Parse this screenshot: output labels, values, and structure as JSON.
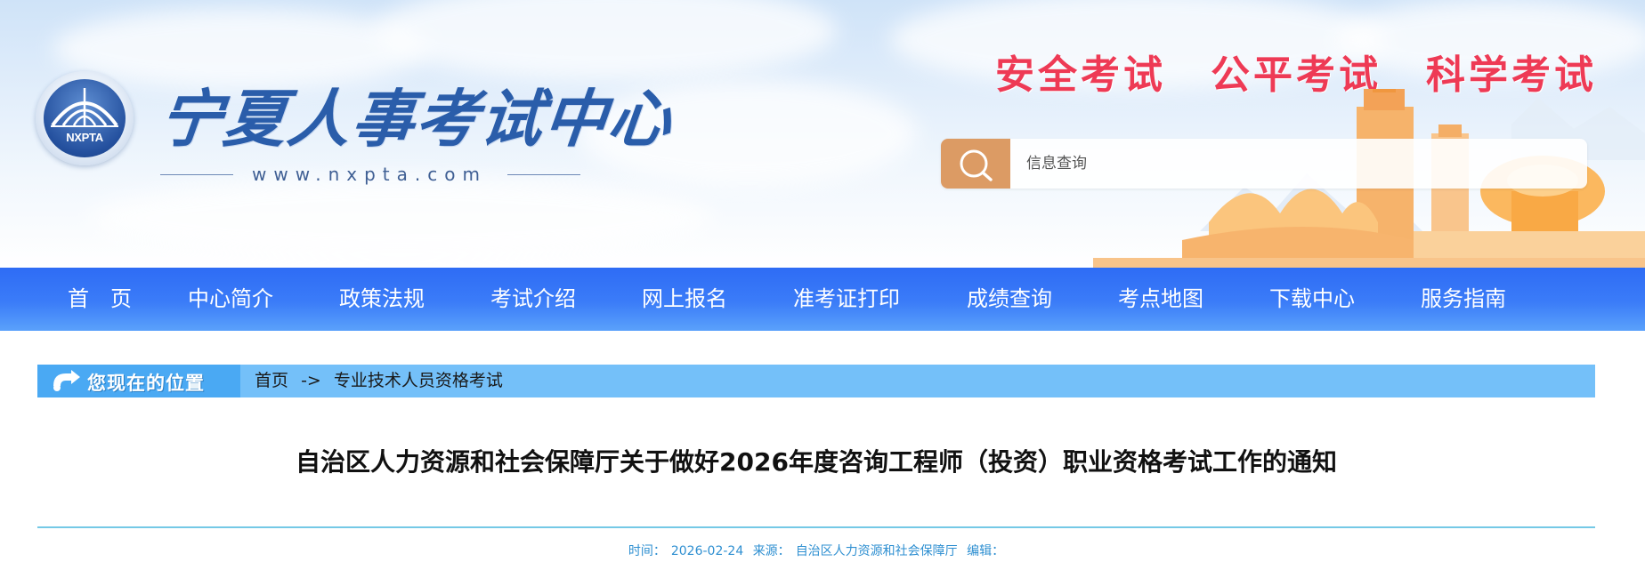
{
  "header": {
    "logo_text": "NXPTA",
    "site_title": "宁夏人事考试中心",
    "site_url": "www.nxpta.com",
    "slogans": [
      "安全考试",
      "公平考试",
      "科学考试"
    ],
    "search": {
      "placeholder": "信息查询",
      "icon": "search-icon"
    },
    "colors": {
      "slogan": "#ee3a55",
      "title": "#2a5daa",
      "search_button": "#dc9b64"
    }
  },
  "nav": {
    "items": [
      "首　页",
      "中心简介",
      "政策法规",
      "考试介绍",
      "网上报名",
      "准考证打印",
      "成绩查询",
      "考点地图",
      "下载中心",
      "服务指南"
    ],
    "colors": {
      "background": "#3b7cf8"
    }
  },
  "breadcrumb": {
    "label": "您现在的位置",
    "home": "首页",
    "separator": "->",
    "current": "专业技术人员资格考试"
  },
  "article": {
    "title": "自治区人力资源和社会保障厅关于做好2026年度咨询工程师（投资）职业资格考试工作的通知",
    "meta": {
      "time_label": "时间：",
      "time_value": "2026-02-24",
      "source_label": "来源：",
      "source_value": "自治区人力资源和社会保障厅",
      "editor_label": "编辑："
    }
  }
}
